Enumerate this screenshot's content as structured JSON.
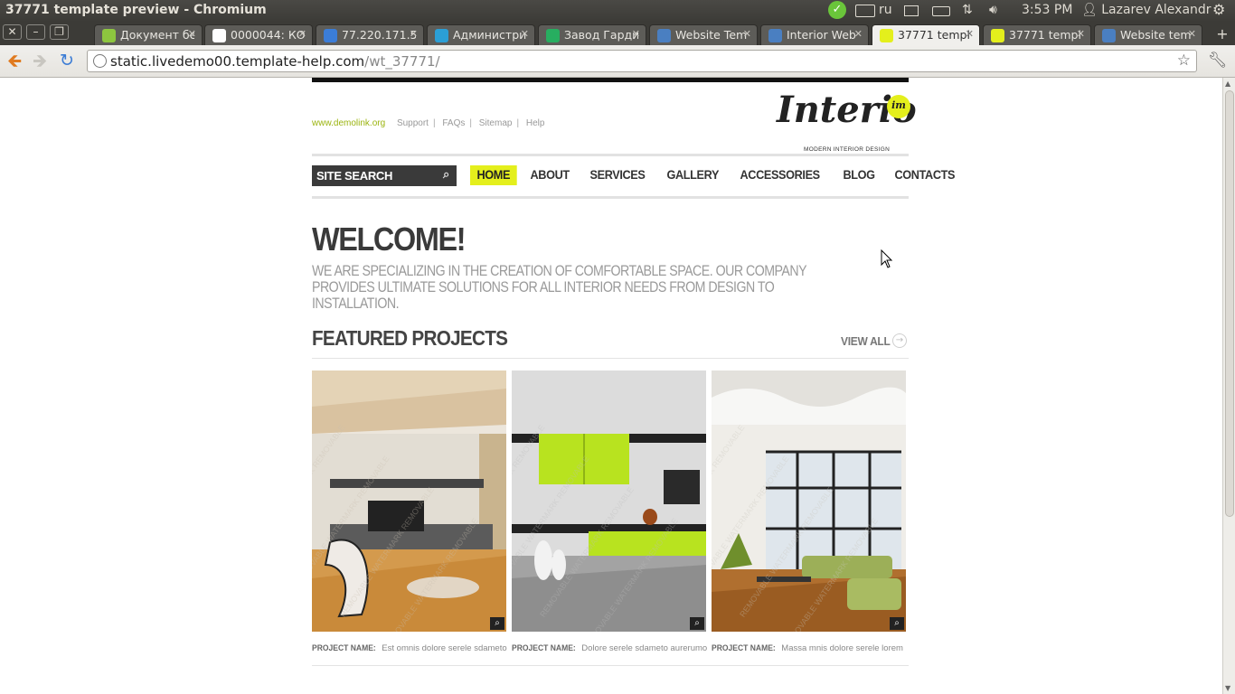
{
  "os": {
    "window_title": "37771 template preview - Chromium",
    "lang": "ru",
    "time": "3:53 PM",
    "user": "Lazarev Alexandr",
    "icons": [
      "check-icon",
      "keyboard-icon",
      "mail-icon",
      "battery-icon",
      "network-icon",
      "volume-icon",
      "user-icon",
      "gear-icon"
    ]
  },
  "window_controls": {
    "close": "✕",
    "minimize": "–",
    "restore": "❐"
  },
  "tabs": [
    {
      "label": "Документ бе",
      "favicon": "#8dc63f",
      "active": false
    },
    {
      "label": "0000044: КО",
      "favicon": "#ffffff",
      "active": false
    },
    {
      "label": "77.220.171.5",
      "favicon": "#3b7dd8",
      "active": false
    },
    {
      "label": "Администри",
      "favicon": "#2b9fd6",
      "active": false
    },
    {
      "label": "Завод Гарди",
      "favicon": "#27ae60",
      "active": false
    },
    {
      "label": "Website Tem",
      "favicon": "#4a7fc1",
      "active": false
    },
    {
      "label": "Interior Web",
      "favicon": "#4a7fc1",
      "active": false
    },
    {
      "label": "37771 templ",
      "favicon": "#e4ef1c",
      "active": true
    },
    {
      "label": "37771 templ",
      "favicon": "#e4ef1c",
      "active": false
    },
    {
      "label": "Website tem",
      "favicon": "#4a7fc1",
      "active": false
    }
  ],
  "toolbar": {
    "url_host": "static.livedemo00.template-help.com",
    "url_path": "/wt_37771/"
  },
  "site": {
    "toplinks": {
      "demo": "www.demolink.org",
      "support": "Support",
      "faqs": "FAQs",
      "sitemap": "Sitemap",
      "help": "Help"
    },
    "logo": {
      "word": "Interio",
      "badge": "im",
      "tagline": "MODERN INTERIOR DESIGN"
    },
    "search_label": "SITE SEARCH",
    "menu": [
      "HOME",
      "ABOUT",
      "SERVICES",
      "GALLERY",
      "ACCESSORIES",
      "BLOG",
      "CONTACTS"
    ],
    "menu_active": "HOME",
    "welcome": "WELCOME!",
    "intro": "WE ARE SPECIALIZING IN THE CREATION OF COMFORTABLE SPACE. OUR COMPANY PROVIDES ULTIMATE SOLUTIONS FOR ALL INTERIOR NEEDS FROM DESIGN TO INSTALLATION.",
    "featured_title": "FEATURED PROJECTS",
    "view_all": "VIEW ALL",
    "projects": [
      {
        "label": "PROJECT NAME:",
        "name": "Est omnis dolore serele sdameto"
      },
      {
        "label": "PROJECT NAME:",
        "name": "Dolore serele sdameto aurerumo"
      },
      {
        "label": "PROJECT NAME:",
        "name": "Massa mnis dolore serele lorem"
      }
    ],
    "accent": "#e4ef1c"
  }
}
